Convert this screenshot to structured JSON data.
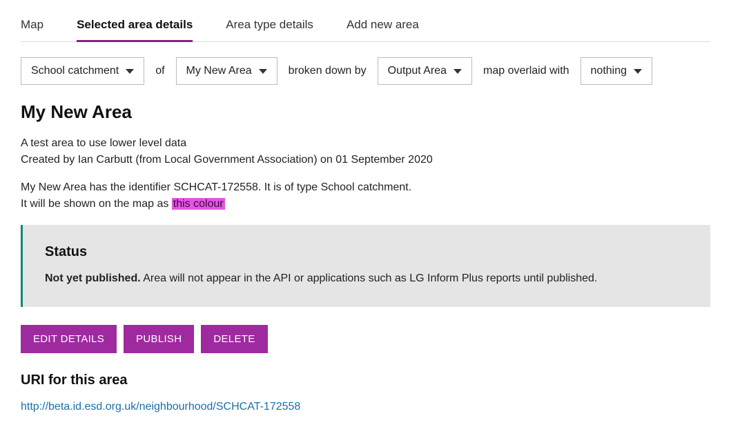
{
  "tabs": {
    "map": "Map",
    "selected": "Selected area details",
    "areaType": "Area type details",
    "addNew": "Add new area"
  },
  "filters": {
    "catchment": "School catchment",
    "ofLabel": "of",
    "areaName": "My New Area",
    "brokenDownLabel": "broken down by",
    "breakdown": "Output Area",
    "overlaidLabel": "map overlaid with",
    "overlay": "nothing"
  },
  "area": {
    "title": "My New Area",
    "description": "A test area to use lower level data",
    "createdBy": "Created by Ian Carbutt (from Local Government Association) on 01 September 2020",
    "identLine": "My New Area has the identifier SCHCAT-172558. It is of type School catchment.",
    "colourPrefix": "It will be shown on the map as ",
    "colourLabel": "this colour"
  },
  "status": {
    "heading": "Status",
    "boldPart": "Not yet published.",
    "rest": " Area will not appear in the API or applications such as LG Inform Plus reports until published."
  },
  "actions": {
    "edit": "EDIT DETAILS",
    "publish": "PUBLISH",
    "delete": "DELETE"
  },
  "uri": {
    "heading": "URI for this area",
    "link": "http://beta.id.esd.org.uk/neighbourhood/SCHCAT-172558"
  }
}
